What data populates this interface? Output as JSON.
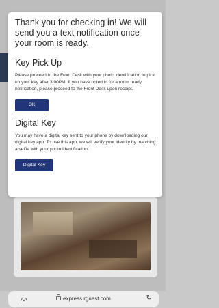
{
  "modal": {
    "title": "Thank you for checking in! We will send you a text notification once your room is ready.",
    "key_pickup": {
      "heading": "Key Pick Up",
      "text": "Please proceed to the Front Desk with your photo identification to pick up your key after 3:00PM. If you have opted in for a room ready notification, please proceed to the Front Desk upon receipt.",
      "button_label": "OK"
    },
    "digital_key": {
      "heading": "Digital Key",
      "text": "You may have a digital key sent to your phone by downloading our digital key app. To use this app, we will verify your identity by matching a selfie with your photo identification.",
      "button_label": "Digital Key"
    }
  },
  "browser": {
    "text_size_label": "AA",
    "url": "express.rguest.com",
    "lock_icon": "lock-icon",
    "reload_icon": "reload-icon"
  },
  "colors": {
    "button_bg": "#223579",
    "modal_bg": "#ffffff",
    "overlay": "#bdbdbd"
  }
}
